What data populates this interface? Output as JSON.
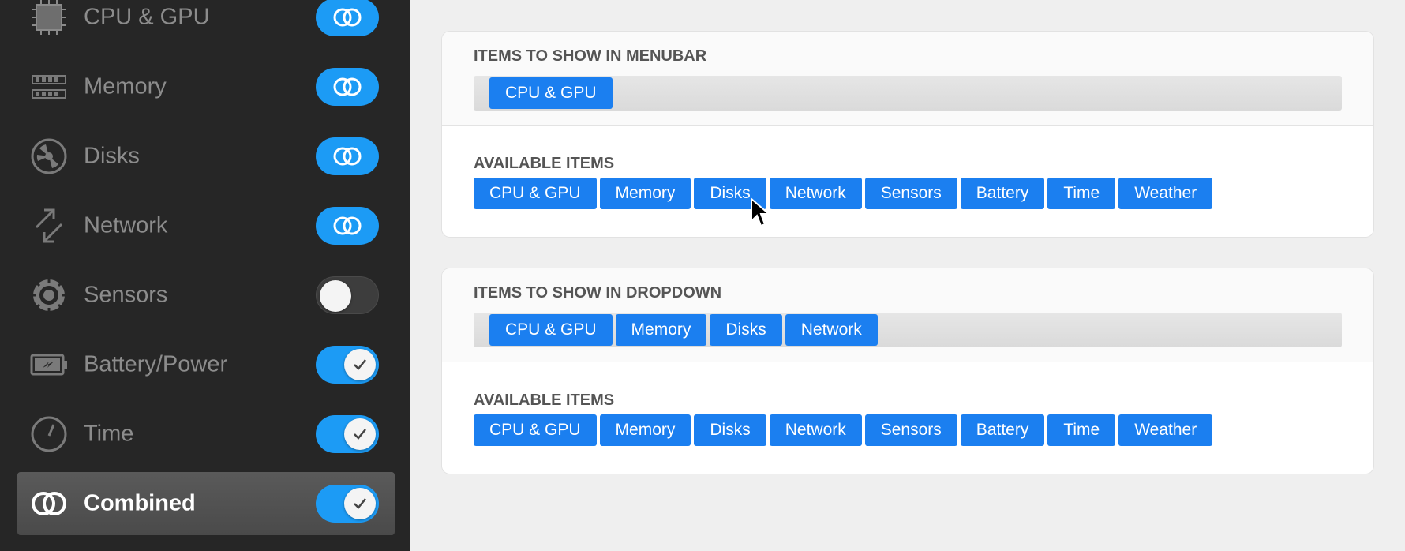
{
  "sidebar": {
    "items": [
      {
        "label": "CPU & GPU",
        "icon": "cpu-icon",
        "toggle": "combined"
      },
      {
        "label": "Memory",
        "icon": "memory-icon",
        "toggle": "combined"
      },
      {
        "label": "Disks",
        "icon": "disk-icon",
        "toggle": "combined"
      },
      {
        "label": "Network",
        "icon": "network-icon",
        "toggle": "combined"
      },
      {
        "label": "Sensors",
        "icon": "sensors-icon",
        "toggle": "off"
      },
      {
        "label": "Battery/Power",
        "icon": "battery-icon",
        "toggle": "on"
      },
      {
        "label": "Time",
        "icon": "clock-icon",
        "toggle": "on"
      },
      {
        "label": "Combined",
        "icon": "combined-rings-icon",
        "toggle": "on",
        "selected": true
      }
    ]
  },
  "menubar_panel": {
    "title": "ITEMS TO SHOW IN MENUBAR",
    "selected_items": [
      "CPU & GPU"
    ],
    "available_title": "AVAILABLE ITEMS",
    "available_items": [
      "CPU & GPU",
      "Memory",
      "Disks",
      "Network",
      "Sensors",
      "Battery",
      "Time",
      "Weather"
    ]
  },
  "dropdown_panel": {
    "title": "ITEMS TO SHOW IN DROPDOWN",
    "selected_items": [
      "CPU & GPU",
      "Memory",
      "Disks",
      "Network"
    ],
    "available_title": "AVAILABLE ITEMS",
    "available_items": [
      "CPU & GPU",
      "Memory",
      "Disks",
      "Network",
      "Sensors",
      "Battery",
      "Time",
      "Weather"
    ]
  },
  "colors": {
    "accent": "#1c9bf5",
    "chip": "#1b7ff0",
    "sidebar_bg": "#262626"
  }
}
